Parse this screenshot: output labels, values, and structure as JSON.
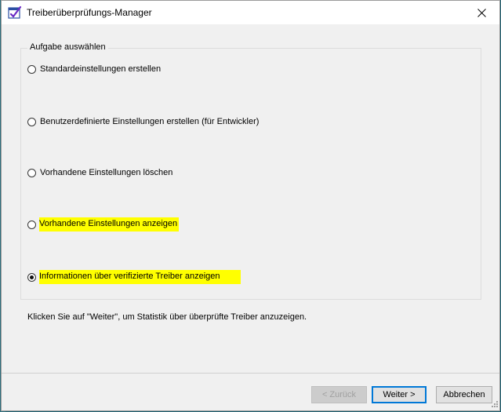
{
  "window": {
    "title": "Treiberüberprüfungs-Manager",
    "icons": {
      "app": "driver-verifier-icon",
      "close": "close-icon",
      "grip": "size-grip-icon"
    }
  },
  "group": {
    "label": "Aufgabe auswählen",
    "options": [
      {
        "label": "Standardeinstellungen erstellen",
        "checked": false,
        "highlighted": false
      },
      {
        "label": "Benutzerdefinierte Einstellungen erstellen (für Entwickler)",
        "checked": false,
        "highlighted": false
      },
      {
        "label": "Vorhandene Einstellungen löschen",
        "checked": false,
        "highlighted": false
      },
      {
        "label": "Vorhandene Einstellungen anzeigen",
        "checked": false,
        "highlighted": true
      },
      {
        "label": "Informationen über verifizierte Treiber anzeigen",
        "checked": true,
        "highlighted": true
      }
    ]
  },
  "hint": "Klicken Sie auf \"Weiter\", um Statistik über überprüfte Treiber anzuzeigen.",
  "buttons": {
    "back": "< Zurück",
    "next": "Weiter >",
    "cancel": "Abbrechen"
  },
  "colors": {
    "highlight": "#ffff00",
    "accent": "#0078d7"
  }
}
